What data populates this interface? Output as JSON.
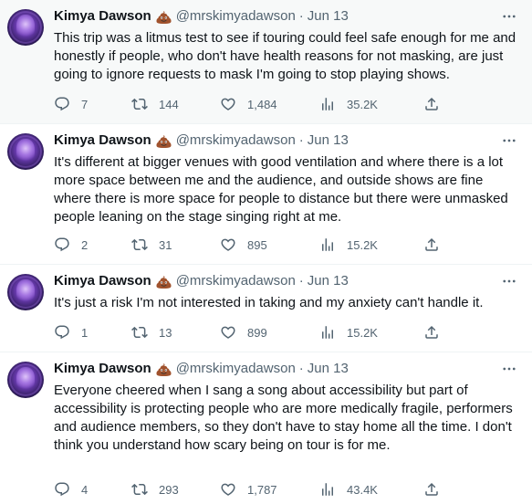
{
  "tweets": [
    {
      "name": "Kimya Dawson",
      "handle": "@mrskimyadawson",
      "separator": "·",
      "date": "Jun 13",
      "text": "This trip was a litmus test to see if touring could feel safe enough for me and honestly if people, who don't have health reasons for not masking, are just going to ignore requests to mask I'm going to stop playing shows.",
      "replies": "7",
      "retweets": "144",
      "likes": "1,484",
      "views": "35.2K"
    },
    {
      "name": "Kimya Dawson",
      "handle": "@mrskimyadawson",
      "separator": "·",
      "date": "Jun 13",
      "text": "It's different at bigger venues with good ventilation and where there is a lot more space between me and the audience, and outside shows are fine where there is more space for people to distance but there were unmasked people leaning on the stage singing right at me.",
      "replies": "2",
      "retweets": "31",
      "likes": "895",
      "views": "15.2K"
    },
    {
      "name": "Kimya Dawson",
      "handle": "@mrskimyadawson",
      "separator": "·",
      "date": "Jun 13",
      "text": "It's just a risk I'm not interested in taking and my anxiety can't handle it.",
      "replies": "1",
      "retweets": "13",
      "likes": "899",
      "views": "15.2K"
    },
    {
      "name": "Kimya Dawson",
      "handle": "@mrskimyadawson",
      "separator": "·",
      "date": "Jun 13",
      "text": "Everyone cheered when I sang a song about accessibility but part of accessibility is protecting people who are more medically fragile, performers and audience members, so they don't have to stay home all the time. I don't think you understand how scary being on tour is for me.",
      "replies": "4",
      "retweets": "293",
      "likes": "1,787",
      "views": "43.4K"
    }
  ],
  "icons": {
    "more": "more-icon",
    "reply": "reply-icon",
    "retweet": "retweet-icon",
    "like": "heart-icon",
    "views": "views-icon",
    "share": "share-icon",
    "emoji": "pile-of-poo-emoji"
  },
  "colors": {
    "text": "#0f1419",
    "secondary": "#536471",
    "highlight_bg": "#f7f9f9",
    "divider": "#eff3f4"
  }
}
